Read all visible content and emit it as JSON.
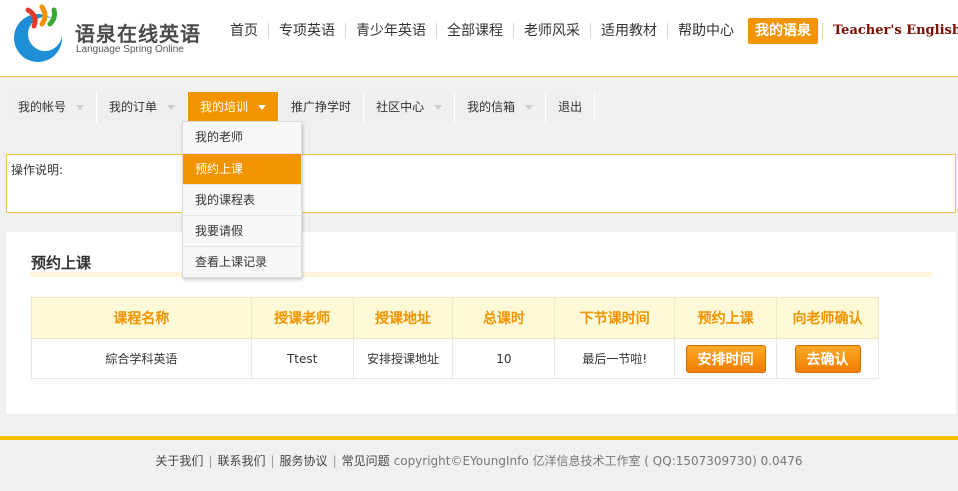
{
  "header": {
    "logo_cn": "语泉在线英语",
    "logo_en": "Language Spring Online",
    "nav": [
      {
        "label": "首页"
      },
      {
        "label": "专项英语"
      },
      {
        "label": "青少年英语"
      },
      {
        "label": "全部课程"
      },
      {
        "label": "老师风采"
      },
      {
        "label": "适用教材"
      },
      {
        "label": "帮助中心"
      },
      {
        "label": "我的语泉"
      },
      {
        "label": "Teacher's English Site"
      }
    ]
  },
  "subnav": {
    "items": [
      {
        "label": "我的帐号"
      },
      {
        "label": "我的订单"
      },
      {
        "label": "我的培训"
      },
      {
        "label": "推广挣学时"
      },
      {
        "label": "社区中心"
      },
      {
        "label": "我的信箱"
      },
      {
        "label": "退出"
      }
    ]
  },
  "dropdown": {
    "items": [
      {
        "label": "我的老师"
      },
      {
        "label": "预约上课"
      },
      {
        "label": "我的课程表"
      },
      {
        "label": "我要请假"
      },
      {
        "label": "查看上课记录"
      }
    ]
  },
  "instructions": {
    "label": "操作说明:"
  },
  "panel": {
    "title": "预约上课",
    "columns": [
      "课程名称",
      "授课老师",
      "授课地址",
      "总课时",
      "下节课时间",
      "预约上课",
      "向老师确认"
    ],
    "row": {
      "course": "綜合学科英语",
      "teacher": "Ttest",
      "address": "安排授课地址",
      "hours": "10",
      "next": "最后一节啦!",
      "book_button": "安排时间",
      "confirm_button": "去确认"
    }
  },
  "footer": {
    "links": [
      "关于我们",
      "联系我们",
      "服务协议",
      "常见问题"
    ],
    "copyright": "copyright©EYoungInfo  亿洋信息技术工作室 ( QQ:1507309730)  0.0476"
  },
  "colors": {
    "accent": "#f29300",
    "gold_line": "#f5c200",
    "header_bg": "#fdf8d6"
  }
}
